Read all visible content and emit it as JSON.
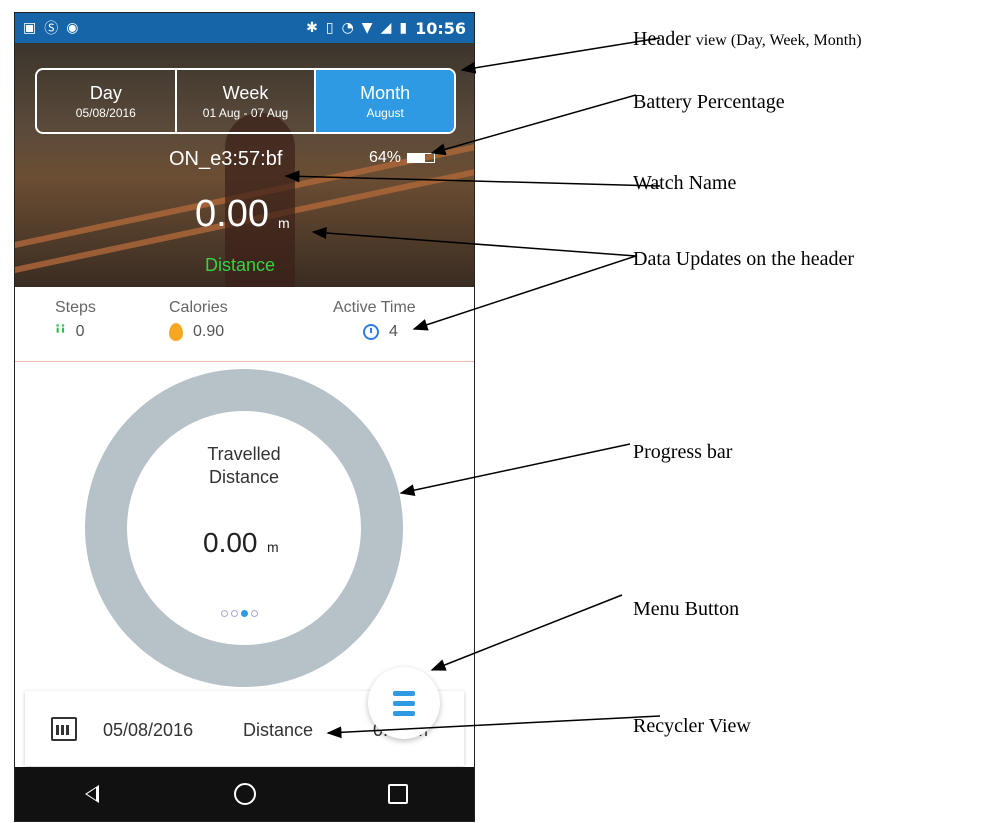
{
  "status_bar": {
    "left_icons": [
      "picture-icon",
      "skype-icon",
      "android-icon"
    ],
    "right_icons": [
      "bluetooth-icon",
      "vibrate-icon",
      "alarm-icon",
      "wifi-icon",
      "no-signal-icon",
      "battery-charging-icon"
    ],
    "time": "10:56"
  },
  "header": {
    "tabs": [
      {
        "label": "Day",
        "sub": "05/08/2016",
        "active": false
      },
      {
        "label": "Week",
        "sub": "01 Aug - 07 Aug",
        "active": false
      },
      {
        "label": "Month",
        "sub": "August",
        "active": true
      }
    ],
    "watch_name": "ON_e3:57:bf",
    "battery_text": "64%",
    "battery_level": 0.64,
    "distance_value": "0.00",
    "distance_unit": "m",
    "distance_label": "Distance"
  },
  "stats": [
    {
      "label": "Steps",
      "value": "0",
      "icon": "footsteps-icon",
      "color": "#2bbf48"
    },
    {
      "label": "Calories",
      "value": "0.90",
      "icon": "flame-icon",
      "color": "#f5a623"
    },
    {
      "label": "Active Time",
      "value": "4",
      "icon": "clock-icon",
      "color": "#2e7ee3"
    }
  ],
  "progress": {
    "title_line1": "Travelled",
    "title_line2": "Distance",
    "value": "0.00",
    "unit": "m",
    "page_dots": 3,
    "active_dot": 2,
    "ring_color": "#b6c2c7"
  },
  "menu_button": {
    "icon": "menu-icon",
    "color": "#2e9ae3"
  },
  "recycler": {
    "rows": [
      {
        "date": "05/08/2016",
        "metric": "Distance",
        "value": "0.00 m"
      }
    ]
  },
  "nav_bar": {
    "buttons": [
      "back-icon",
      "home-icon",
      "recent-apps-icon"
    ]
  },
  "annotations": {
    "header_view": "Header",
    "header_view_detail": "view (Day, Week, Month)",
    "battery": "Battery Percentage",
    "watch_name": "Watch Name",
    "data_updates": "Data Updates on the header",
    "progress_bar": "Progress bar",
    "menu_button": "Menu Button",
    "recycler_view": "Recycler View"
  },
  "colors": {
    "status_bar": "#1565a8",
    "accent": "#2e9ae3",
    "distance_label": "#31d640"
  }
}
